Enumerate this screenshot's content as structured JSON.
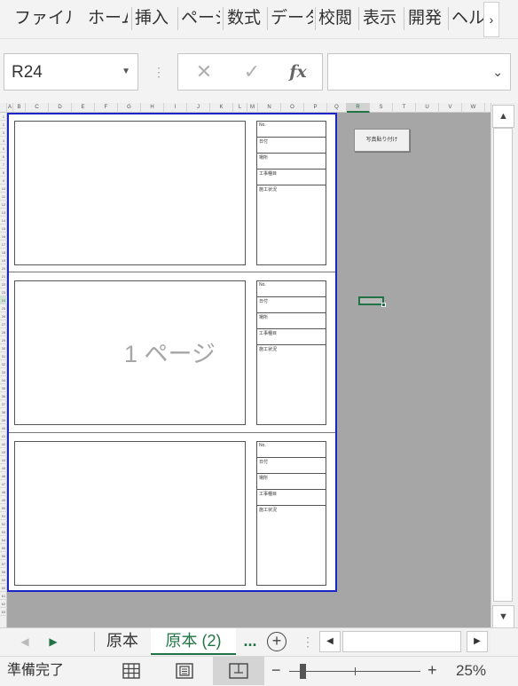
{
  "ribbon": {
    "tabs": [
      "ファイル",
      "ホーム",
      "挿入",
      "ページ",
      "数式",
      "データ",
      "校閲",
      "表示",
      "開発",
      "ヘル"
    ],
    "scroll_label": "›"
  },
  "formula_bar": {
    "name_box": "R24",
    "cancel_icon": "✕",
    "enter_icon": "✓",
    "fx_label": "fx",
    "content": ""
  },
  "sheet": {
    "columns": [
      "A",
      "B",
      "C",
      "D",
      "E",
      "F",
      "G",
      "H",
      "I",
      "J",
      "K",
      "L",
      "M",
      "N",
      "O",
      "P",
      "Q",
      "R",
      "S",
      "T",
      "U",
      "V",
      "W"
    ],
    "selected_column": "R",
    "selected_row": "24",
    "page_watermark": "1 ページ",
    "photo_button_label": "写真貼り付け",
    "info_labels": [
      "No.",
      "日付",
      "場所",
      "工事種目",
      "施工状況"
    ]
  },
  "sheet_tabs": {
    "tabs": [
      "原本",
      "原本 (2)"
    ],
    "active_index": 1,
    "more_label": "...",
    "add_label": "+"
  },
  "status_bar": {
    "ready": "準備完了",
    "zoom_minus": "−",
    "zoom_plus": "+",
    "zoom": "25%"
  },
  "colors": {
    "accent": "#217346",
    "page_border": "#1a24c8",
    "sheet_background": "#a6a6a6"
  }
}
